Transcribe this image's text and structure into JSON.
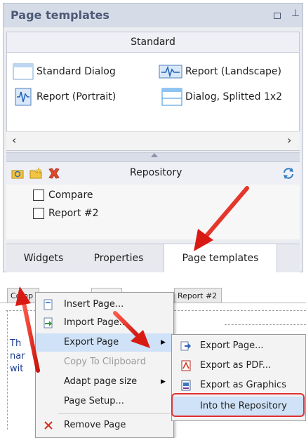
{
  "panel": {
    "title": "Page templates",
    "standard_header": "Standard",
    "templates": [
      {
        "label": "Standard Dialog",
        "icon": "dialog-icon"
      },
      {
        "label": "Report (Landscape)",
        "icon": "report-landscape-icon"
      },
      {
        "label": "Report (Portrait)",
        "icon": "report-portrait-icon"
      },
      {
        "label": "Dialog, Splitted 1x2",
        "icon": "dialog-split-icon"
      }
    ],
    "repository": {
      "title": "Repository",
      "items": [
        {
          "label": "Compare"
        },
        {
          "label": "Report #2"
        }
      ]
    },
    "tabs": [
      {
        "label": "Widgets"
      },
      {
        "label": "Properties"
      },
      {
        "label": "Page templates",
        "active": true
      }
    ]
  },
  "document": {
    "tabs": [
      {
        "label": "Comp"
      },
      {
        "label": "Report #2"
      }
    ],
    "text_lines": [
      "Th",
      "nar",
      "wit"
    ]
  },
  "context_menu": {
    "items": [
      {
        "label": "Insert Page...",
        "icon": "insert-page-icon"
      },
      {
        "label": "Import Page...",
        "icon": "import-page-icon"
      },
      {
        "label": "Export Page",
        "has_submenu": true,
        "highlighted": true
      },
      {
        "label": "Copy To Clipboard",
        "disabled": true
      },
      {
        "label": "Adapt page size",
        "has_submenu": true
      },
      {
        "label": "Page Setup..."
      },
      {
        "label": "Remove Page",
        "icon": "remove-icon"
      }
    ]
  },
  "submenu": {
    "items": [
      {
        "label": "Export Page...",
        "icon": "export-page-icon"
      },
      {
        "label": "Export as PDF...",
        "icon": "pdf-icon"
      },
      {
        "label": "Export as Graphics",
        "icon": "image-icon"
      },
      {
        "label": "Into the Repository",
        "highlighted": true
      }
    ]
  },
  "colors": {
    "accent_arrow": "#e42828",
    "panel_title": "#4c5a76",
    "highlight": "#cfe2f7",
    "outline": "#e23030"
  }
}
